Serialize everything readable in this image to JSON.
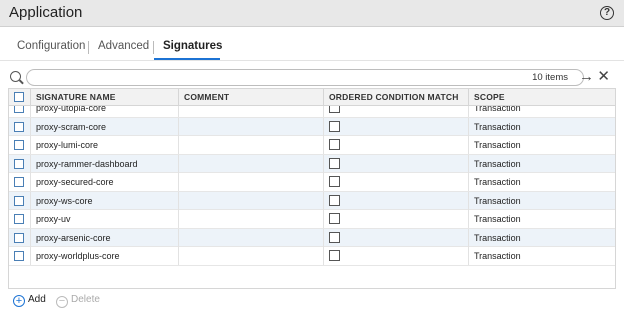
{
  "window": {
    "title": "Application",
    "help_icon": "?"
  },
  "tabs": [
    {
      "label": "Configuration",
      "active": false
    },
    {
      "label": "Advanced",
      "active": false
    },
    {
      "label": "Signatures",
      "active": true
    }
  ],
  "search": {
    "placeholder": "",
    "value": "",
    "items_count": "10 items",
    "go_icon": "→",
    "clear_icon": "✕"
  },
  "table": {
    "columns": [
      "SIGNATURE NAME",
      "COMMENT",
      "ORDERED CONDITION MATCH",
      "SCOPE"
    ],
    "rows": [
      {
        "name": "proxy-utopia-core",
        "comment": "",
        "ordered": false,
        "scope": "Transaction"
      },
      {
        "name": "proxy-scram-core",
        "comment": "",
        "ordered": false,
        "scope": "Transaction"
      },
      {
        "name": "proxy-lumi-core",
        "comment": "",
        "ordered": false,
        "scope": "Transaction"
      },
      {
        "name": "proxy-rammer-dashboard",
        "comment": "",
        "ordered": false,
        "scope": "Transaction"
      },
      {
        "name": "proxy-secured-core",
        "comment": "",
        "ordered": false,
        "scope": "Transaction"
      },
      {
        "name": "proxy-ws-core",
        "comment": "",
        "ordered": false,
        "scope": "Transaction"
      },
      {
        "name": "proxy-uv",
        "comment": "",
        "ordered": false,
        "scope": "Transaction"
      },
      {
        "name": "proxy-arsenic-core",
        "comment": "",
        "ordered": false,
        "scope": "Transaction"
      },
      {
        "name": "proxy-worldplus-core",
        "comment": "",
        "ordered": false,
        "scope": "Transaction"
      }
    ]
  },
  "footer": {
    "add_label": "Add",
    "delete_label": "Delete",
    "add_icon": "+",
    "delete_icon": "−"
  },
  "colors": {
    "accent": "#1c73d4",
    "row_alt": "#edf3f9",
    "header_bg": "#e8e8e8"
  }
}
